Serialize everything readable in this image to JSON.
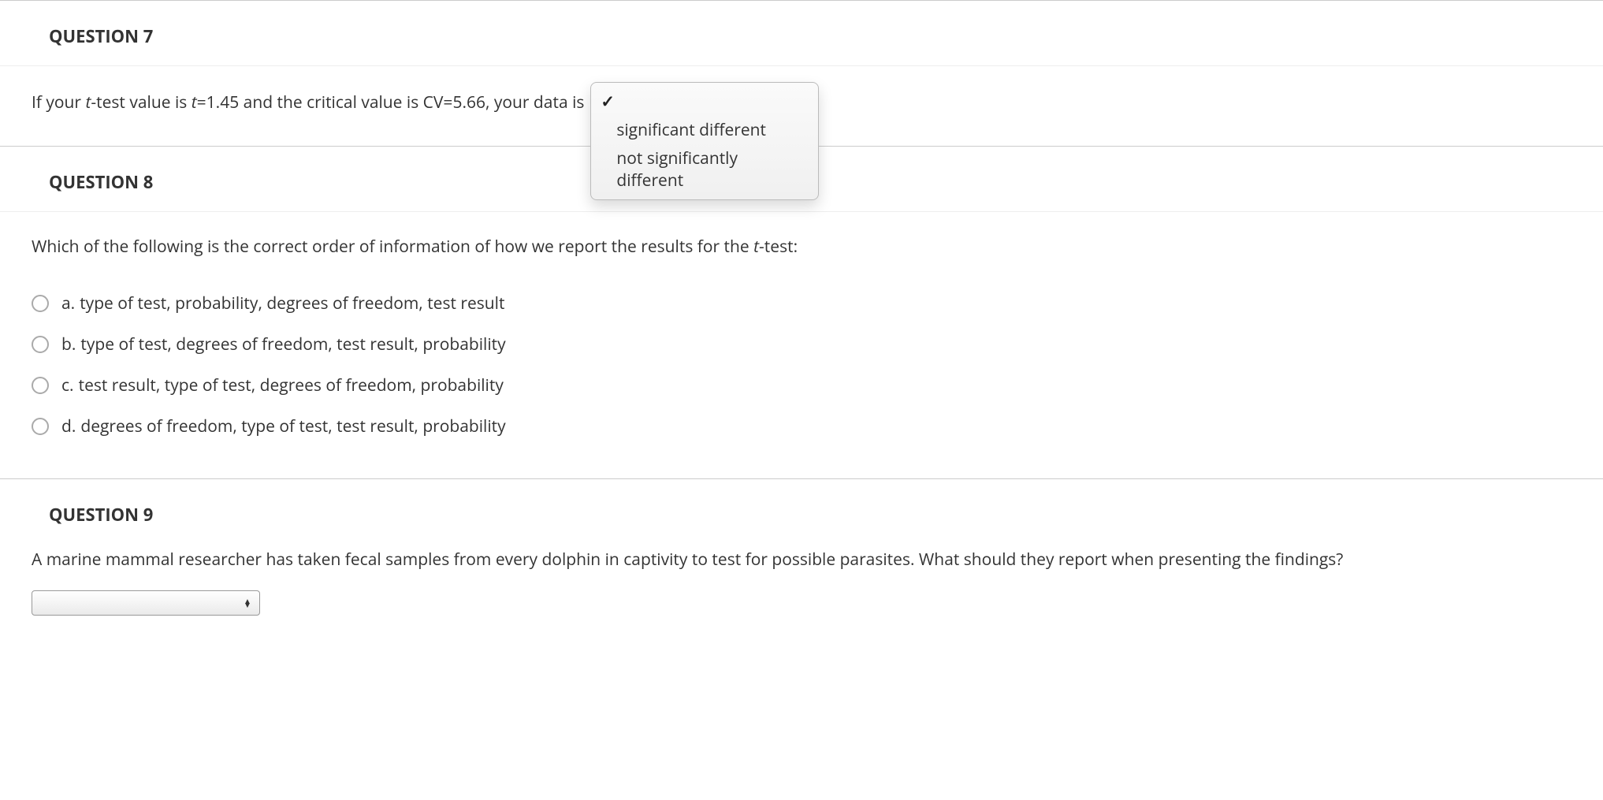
{
  "q7": {
    "header": "QUESTION 7",
    "text_prefix": "If your ",
    "t_word": "t",
    "text_mid": "-test value is ",
    "t_var": "t",
    "text_eq1": "=1.45 and the critical value is CV=5.66, your data is",
    "dropdown": {
      "check_label": "",
      "options": [
        "significant different",
        "not significantly different"
      ]
    }
  },
  "q8": {
    "header": "QUESTION 8",
    "text_prefix": "Which of the following is the correct order of information of how we report the results for the ",
    "t_word": "t",
    "text_suffix": "-test:",
    "options": [
      {
        "letter": "a.",
        "text": "type of test, probability, degrees of freedom, test result"
      },
      {
        "letter": "b.",
        "text": "type of test, degrees of freedom, test result, probability"
      },
      {
        "letter": "c.",
        "text": "test result, type of test, degrees of freedom, probability"
      },
      {
        "letter": "d.",
        "text": "degrees of freedom, type of test, test result, probability"
      }
    ]
  },
  "q9": {
    "header": "QUESTION 9",
    "text": "A marine mammal researcher has taken fecal samples from every dolphin in captivity to test for possible parasites. What should they report when presenting the findings?"
  }
}
